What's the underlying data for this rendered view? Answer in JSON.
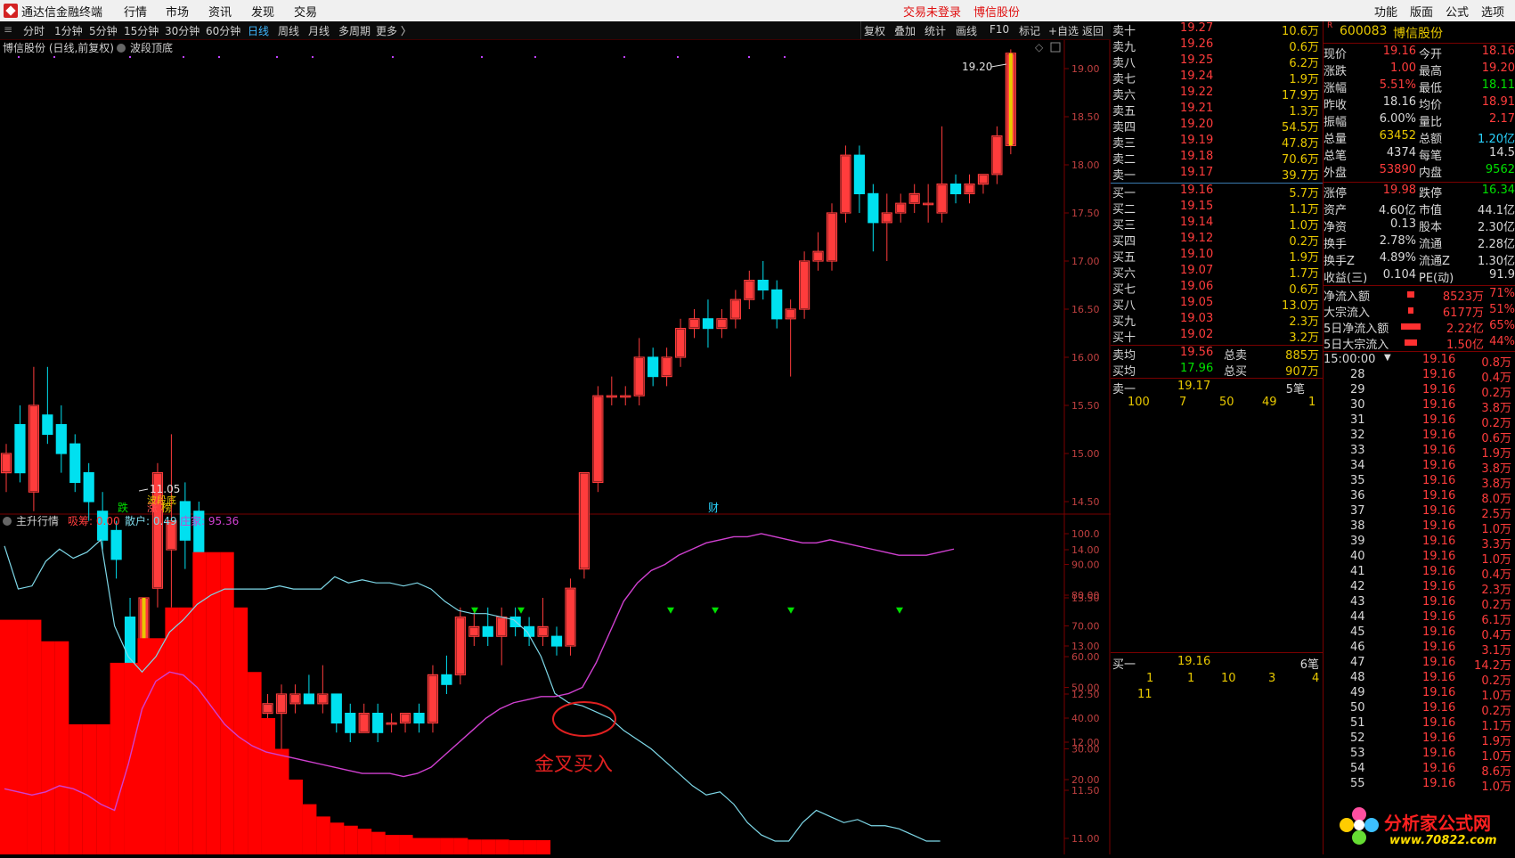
{
  "titlebar": {
    "app_name": "通达信金融终端",
    "menus": [
      "行情",
      "市场",
      "资讯",
      "发现",
      "交易"
    ],
    "trade_status": "交易未登录",
    "stock_name": "博信股份",
    "right_menus": [
      "功能",
      "版面",
      "公式",
      "选项"
    ]
  },
  "toolbar": {
    "periods": [
      "分时",
      "1分钟",
      "5分钟",
      "15分钟",
      "30分钟",
      "60分钟",
      "日线",
      "周线",
      "月线",
      "多周期",
      "更多 〉"
    ],
    "active_period": "日线",
    "actions": [
      "复权",
      "叠加",
      "统计",
      "画线",
      "F10",
      "标记",
      "+自选",
      "返回"
    ]
  },
  "chart": {
    "header": "博信股份 (日线,前复权)",
    "indicator_name": "波段顶底",
    "high_label": "19.20",
    "low_label": "11.05",
    "low_tag": "波段底",
    "markers": {
      "die": "跌",
      "zhang": "涨",
      "bang": "榜",
      "cai": "财"
    },
    "price_axis": [
      "19.00",
      "18.50",
      "18.00",
      "17.50",
      "17.00",
      "16.50",
      "16.00",
      "15.50",
      "15.00",
      "14.50",
      "14.00",
      "13.50",
      "13.00",
      "12.50",
      "12.00",
      "11.50",
      "11.00"
    ],
    "sub_title": "主升行情",
    "sub_labels": {
      "xichou_label": "吸筹:",
      "xichou": "0.00",
      "sanhu_label": "散户:",
      "sanhu": "0.49",
      "zhuangjia_label": "庄家:",
      "zhuangjia": "95.36"
    },
    "sub_axis": [
      "100.0",
      "90.00",
      "80.00",
      "70.00",
      "60.00",
      "50.00",
      "40.00",
      "30.00",
      "20.00"
    ],
    "annotation": "金叉买入",
    "colors": {
      "up": "#ff3c3c",
      "down": "#00e0f0",
      "sanhu_line": "#7ed8e8",
      "zhuangjia_line": "#d040d0",
      "xichou_bar": "#ff0000"
    }
  },
  "orderbook": {
    "asks": [
      {
        "label": "卖十",
        "price": "19.27",
        "vol": "10.6万"
      },
      {
        "label": "卖九",
        "price": "19.26",
        "vol": "0.6万"
      },
      {
        "label": "卖八",
        "price": "19.25",
        "vol": "6.2万"
      },
      {
        "label": "卖七",
        "price": "19.24",
        "vol": "1.9万"
      },
      {
        "label": "卖六",
        "price": "19.22",
        "vol": "17.9万"
      },
      {
        "label": "卖五",
        "price": "19.21",
        "vol": "1.3万"
      },
      {
        "label": "卖四",
        "price": "19.20",
        "vol": "54.5万"
      },
      {
        "label": "卖三",
        "price": "19.19",
        "vol": "47.8万"
      },
      {
        "label": "卖二",
        "price": "19.18",
        "vol": "70.6万"
      },
      {
        "label": "卖一",
        "price": "19.17",
        "vol": "39.7万"
      }
    ],
    "bids": [
      {
        "label": "买一",
        "price": "19.16",
        "vol": "5.7万"
      },
      {
        "label": "买二",
        "price": "19.15",
        "vol": "1.1万"
      },
      {
        "label": "买三",
        "price": "19.14",
        "vol": "1.0万"
      },
      {
        "label": "买四",
        "price": "19.12",
        "vol": "0.2万"
      },
      {
        "label": "买五",
        "price": "19.10",
        "vol": "1.9万"
      },
      {
        "label": "买六",
        "price": "19.07",
        "vol": "1.7万"
      },
      {
        "label": "买七",
        "price": "19.06",
        "vol": "0.6万"
      },
      {
        "label": "买八",
        "price": "19.05",
        "vol": "13.0万"
      },
      {
        "label": "买九",
        "price": "19.03",
        "vol": "2.3万"
      },
      {
        "label": "买十",
        "price": "19.02",
        "vol": "3.2万"
      }
    ],
    "avg": [
      {
        "label": "卖均",
        "price": "19.56",
        "tlabel": "总卖",
        "tval": "885万"
      },
      {
        "label": "买均",
        "price": "17.96",
        "tlabel": "总买",
        "tval": "907万"
      }
    ],
    "sell1_queue": {
      "label": "卖一",
      "price": "19.17",
      "count": "5笔",
      "orders": [
        "100",
        "7",
        "50",
        "49",
        "1"
      ]
    },
    "buy1_queue": {
      "label": "买一",
      "price": "19.16",
      "count": "6笔",
      "orders": [
        "1",
        "1",
        "10",
        "3",
        "4",
        "11"
      ]
    }
  },
  "quote": {
    "code": "600083",
    "name": "博信股份",
    "rows": [
      {
        "l1": "现价",
        "v1": "19.16",
        "l2": "今开",
        "v2": "18.16"
      },
      {
        "l1": "涨跌",
        "v1": "1.00",
        "l2": "最高",
        "v2": "19.20"
      },
      {
        "l1": "涨幅",
        "v1": "5.51%",
        "l2": "最低",
        "v2": "18.11"
      },
      {
        "l1": "昨收",
        "v1": "18.16",
        "l2": "均价",
        "v2": "18.91"
      },
      {
        "l1": "振幅",
        "v1": "6.00%",
        "l2": "量比",
        "v2": "2.17"
      },
      {
        "l1": "总量",
        "v1": "63452",
        "l2": "总额",
        "v2": "1.20亿"
      },
      {
        "l1": "总笔",
        "v1": "4374",
        "l2": "每笔",
        "v2": "14.5"
      },
      {
        "l1": "外盘",
        "v1": "53890",
        "l2": "内盘",
        "v2": "9562"
      }
    ],
    "rows2": [
      {
        "l1": "涨停",
        "v1": "19.98",
        "l2": "跌停",
        "v2": "16.34"
      },
      {
        "l1": "资产",
        "v1": "4.60亿",
        "l2": "市值",
        "v2": "44.1亿"
      },
      {
        "l1": "净资",
        "v1": "0.13",
        "l2": "股本",
        "v2": "2.30亿"
      },
      {
        "l1": "换手",
        "v1": "2.78%",
        "l2": "流通",
        "v2": "2.28亿"
      },
      {
        "l1": "换手Z",
        "v1": "4.89%",
        "l2": "流通Z",
        "v2": "1.30亿"
      },
      {
        "l1": "收益(三)",
        "v1": "0.104",
        "l2": "PE(动)",
        "v2": "91.9"
      }
    ],
    "flows": [
      {
        "label": "净流入额",
        "val": "8523万",
        "pct": "71%"
      },
      {
        "label": "大宗流入",
        "val": "6177万",
        "pct": "51%"
      },
      {
        "label": "5日净流入额",
        "val": "2.22亿",
        "pct": "65%"
      },
      {
        "label": "5日大宗流入",
        "val": "1.50亿",
        "pct": "44%"
      }
    ],
    "tick_head": {
      "time": "15:00:00",
      "price": "19.16",
      "vol": "0.8万"
    },
    "ticks": [
      {
        "t": "28",
        "p": "19.16",
        "v": "0.4万"
      },
      {
        "t": "29",
        "p": "19.16",
        "v": "0.2万"
      },
      {
        "t": "30",
        "p": "19.16",
        "v": "3.8万"
      },
      {
        "t": "31",
        "p": "19.16",
        "v": "0.2万"
      },
      {
        "t": "32",
        "p": "19.16",
        "v": "0.6万"
      },
      {
        "t": "33",
        "p": "19.16",
        "v": "1.9万"
      },
      {
        "t": "34",
        "p": "19.16",
        "v": "3.8万"
      },
      {
        "t": "35",
        "p": "19.16",
        "v": "3.8万"
      },
      {
        "t": "36",
        "p": "19.16",
        "v": "8.0万"
      },
      {
        "t": "37",
        "p": "19.16",
        "v": "2.5万"
      },
      {
        "t": "38",
        "p": "19.16",
        "v": "1.0万"
      },
      {
        "t": "39",
        "p": "19.16",
        "v": "3.3万"
      },
      {
        "t": "40",
        "p": "19.16",
        "v": "1.0万"
      },
      {
        "t": "41",
        "p": "19.16",
        "v": "0.4万"
      },
      {
        "t": "42",
        "p": "19.16",
        "v": "2.3万"
      },
      {
        "t": "43",
        "p": "19.16",
        "v": "0.2万"
      },
      {
        "t": "44",
        "p": "19.16",
        "v": "6.1万"
      },
      {
        "t": "45",
        "p": "19.16",
        "v": "0.4万"
      },
      {
        "t": "46",
        "p": "19.16",
        "v": "3.1万"
      },
      {
        "t": "47",
        "p": "19.16",
        "v": "14.2万"
      },
      {
        "t": "48",
        "p": "19.16",
        "v": "0.2万"
      },
      {
        "t": "49",
        "p": "19.16",
        "v": "1.0万"
      },
      {
        "t": "50",
        "p": "19.16",
        "v": "0.2万"
      },
      {
        "t": "51",
        "p": "19.16",
        "v": "1.1万"
      },
      {
        "t": "52",
        "p": "19.16",
        "v": "1.9万"
      },
      {
        "t": "53",
        "p": "19.16",
        "v": "1.0万"
      },
      {
        "t": "54",
        "p": "19.16",
        "v": "8.6万"
      },
      {
        "t": "55",
        "p": "19.16",
        "v": "1.0万"
      }
    ],
    "watermark_title": "分析家公式网",
    "watermark_url": "www.70822.com"
  }
}
